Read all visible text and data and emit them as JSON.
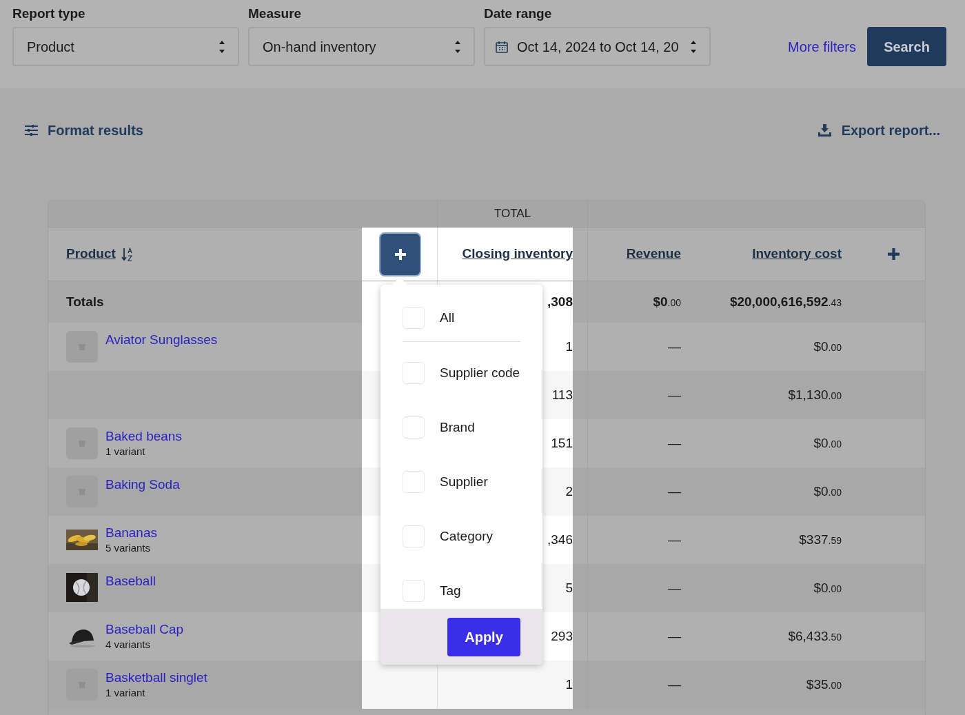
{
  "filters": [
    {
      "label": "Report type",
      "value": "Product",
      "kind": "select"
    },
    {
      "label": "Measure",
      "value": "On-hand inventory",
      "kind": "select"
    },
    {
      "label": "Date range",
      "value": "Oct 14, 2024 to Oct 14, 20",
      "kind": "date"
    }
  ],
  "more_filters": "More filters",
  "search_button": "Search",
  "format_results": "Format results",
  "export_report": "Export report...",
  "table": {
    "group_header": "TOTAL",
    "columns": [
      "Product",
      "Closing inventory",
      "Revenue",
      "Inventory cost"
    ],
    "totals": {
      "label": "Totals",
      "closing": ",308",
      "revenue": {
        "amount": "$0",
        "cents": ".00"
      },
      "cost": {
        "amount": "$20,000,616,592",
        "cents": ".43"
      }
    },
    "rows": [
      {
        "name": "Aviator Sunglasses",
        "kind": "placeholder",
        "closing": "1",
        "revenue": {
          "amount": "—"
        },
        "cost": {
          "amount": "$0",
          "cents": ".00"
        }
      },
      {
        "closing": "113",
        "revenue": {
          "amount": "—"
        },
        "cost": {
          "amount": "$1,130",
          "cents": ".00"
        }
      },
      {
        "name": "Baked beans",
        "variants": "1 variant",
        "kind": "placeholder",
        "closing": "151",
        "revenue": {
          "amount": "—"
        },
        "cost": {
          "amount": "$0",
          "cents": ".00"
        }
      },
      {
        "name": "Baking Soda",
        "kind": "placeholder",
        "closing": "2",
        "revenue": {
          "amount": "—"
        },
        "cost": {
          "amount": "$0",
          "cents": ".00"
        }
      },
      {
        "name": "Bananas",
        "variants": "5 variants",
        "kind": "picture",
        "closing": ",346",
        "revenue": {
          "amount": "—"
        },
        "cost": {
          "amount": "$337",
          "cents": ".59"
        }
      },
      {
        "name": "Baseball",
        "kind": "picture",
        "closing": "5",
        "revenue": {
          "amount": "—"
        },
        "cost": {
          "amount": "$0",
          "cents": ".00"
        }
      },
      {
        "name": "Baseball Cap",
        "variants": "4 variants",
        "kind": "picture",
        "closing": "293",
        "revenue": {
          "amount": "—"
        },
        "cost": {
          "amount": "$6,433",
          "cents": ".50"
        }
      },
      {
        "name": "Basketball singlet",
        "variants": "1 variant",
        "kind": "placeholder",
        "closing": "1",
        "revenue": {
          "amount": "—"
        },
        "cost": {
          "amount": "$35",
          "cents": ".00"
        }
      }
    ]
  },
  "column_menu": {
    "items": [
      {
        "label": "All",
        "checked": false
      },
      {
        "label": "Supplier code",
        "checked": false
      },
      {
        "label": "Brand",
        "checked": false
      },
      {
        "label": "Supplier",
        "checked": false
      },
      {
        "label": "Category",
        "checked": false
      },
      {
        "label": "Tag",
        "checked": false
      }
    ],
    "apply_button": "Apply"
  }
}
